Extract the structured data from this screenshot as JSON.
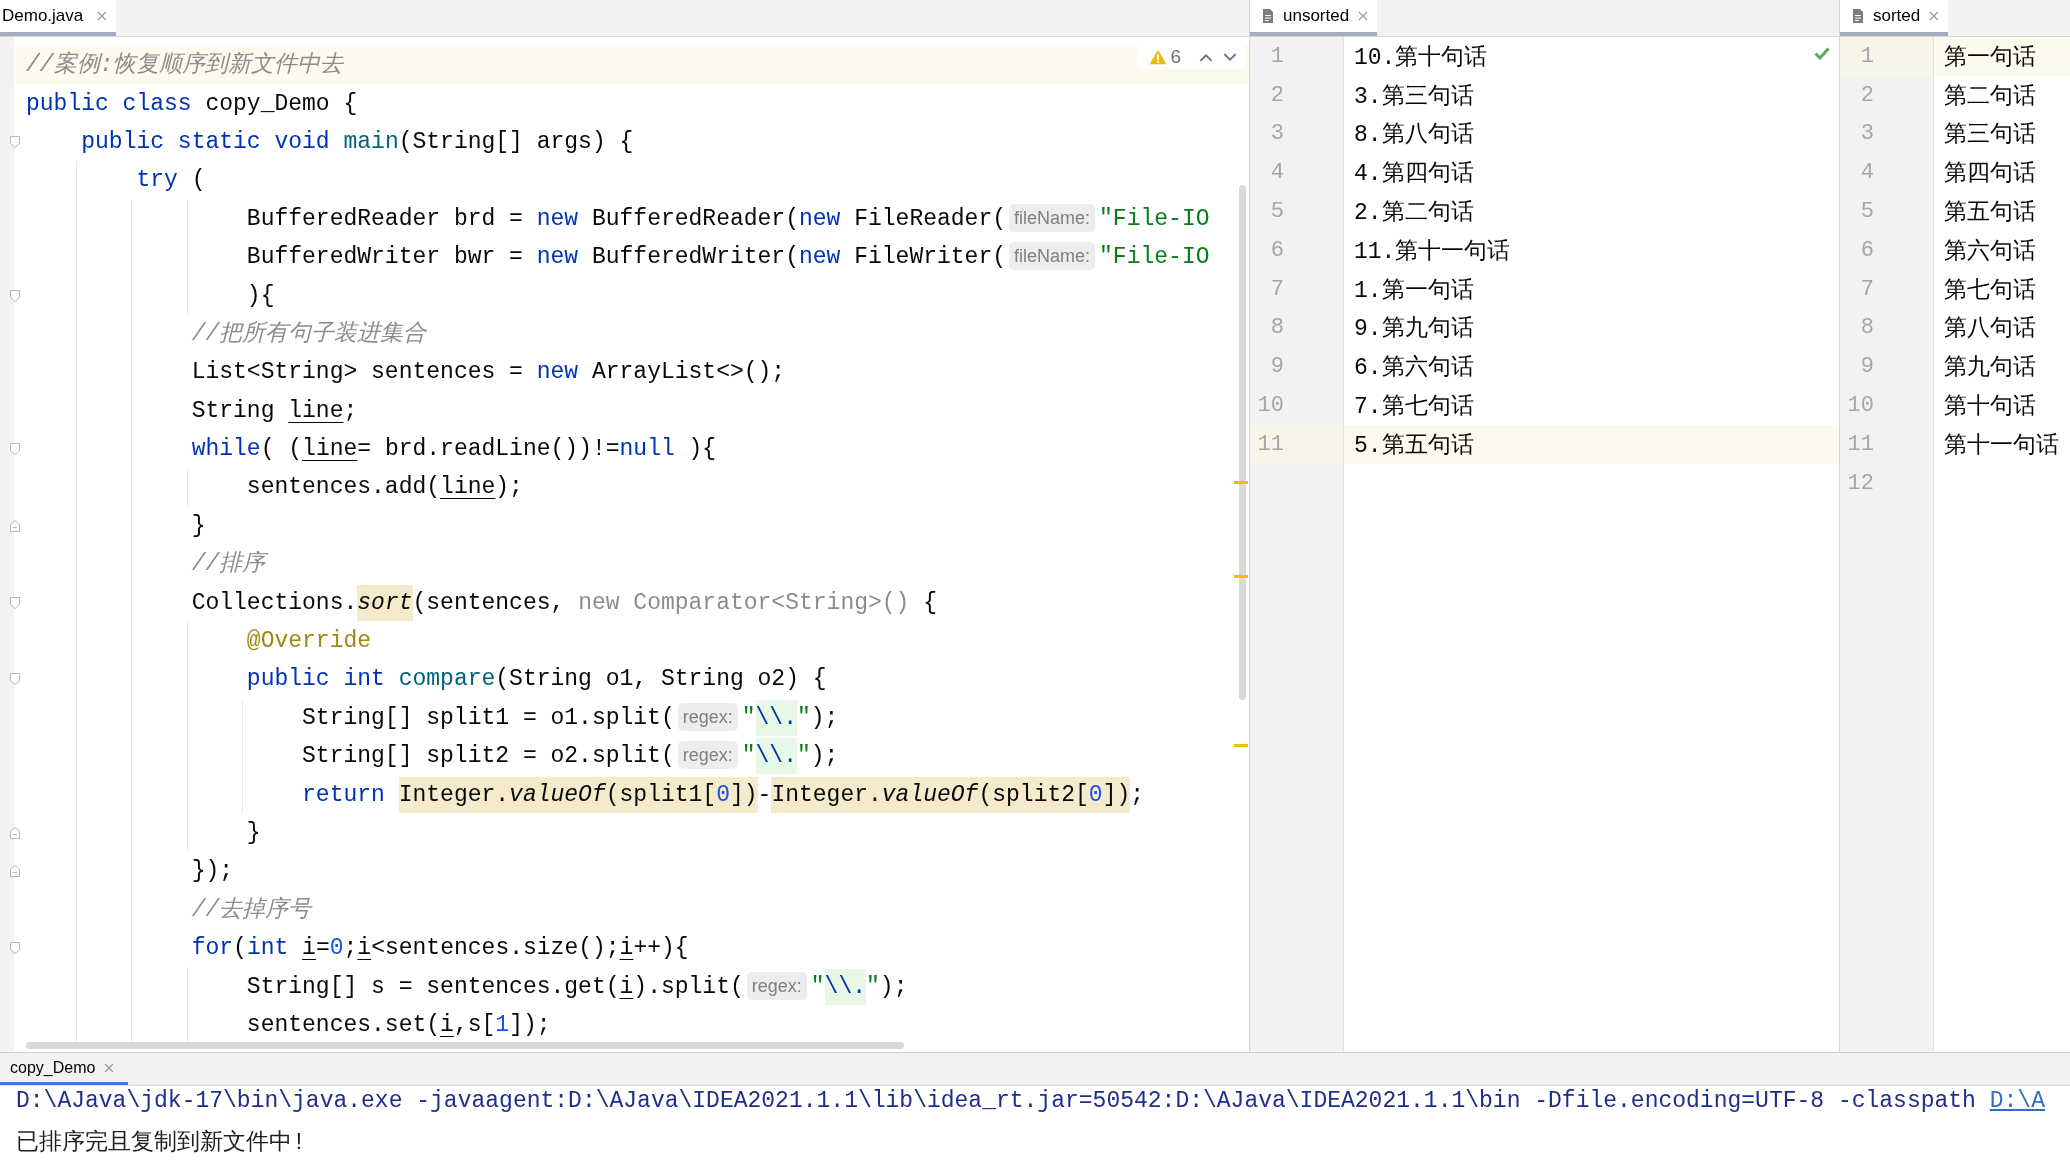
{
  "editor": {
    "tabs": [
      {
        "label": "Demo.java",
        "selected": true
      }
    ],
    "inspection": {
      "warning_count": "6"
    },
    "lines": [
      {
        "kind": "plain",
        "current": true,
        "tokens": [
          {
            "text": "//案例:恢复顺序到新文件中去",
            "kind": "comment"
          }
        ]
      },
      {
        "kind": "plain",
        "current": false,
        "tokens": [
          {
            "text": "public class",
            "kind": "keyword"
          },
          {
            "text": " copy_Demo {",
            "kind": "plain"
          }
        ]
      },
      {
        "kind": "fold_start",
        "current": false,
        "tokens": [
          {
            "text": "    public static void",
            "kind": "keyword"
          },
          {
            "text": " main",
            "kind": "method"
          },
          {
            "text": "(String[] args) {",
            "kind": "plain"
          }
        ]
      },
      {
        "kind": "plain",
        "current": false,
        "tokens": [
          {
            "text": "        try",
            "kind": "keyword"
          },
          {
            "text": " (",
            "kind": "plain"
          }
        ]
      },
      {
        "kind": "plain",
        "current": false,
        "tokens": [
          {
            "text": "                BufferedReader brd = ",
            "kind": "plain"
          },
          {
            "text": "new",
            "kind": "keyword"
          },
          {
            "text": " BufferedReader(",
            "kind": "plain"
          },
          {
            "text": "new",
            "kind": "keyword"
          },
          {
            "text": " FileReader(",
            "kind": "plain"
          },
          {
            "text": "fileName:",
            "kind": "hint"
          },
          {
            "text": "\"File-IO",
            "kind": "string"
          }
        ]
      },
      {
        "kind": "plain",
        "current": false,
        "tokens": [
          {
            "text": "                BufferedWriter bwr = ",
            "kind": "plain"
          },
          {
            "text": "new",
            "kind": "keyword"
          },
          {
            "text": " BufferedWriter(",
            "kind": "plain"
          },
          {
            "text": "new",
            "kind": "keyword"
          },
          {
            "text": " FileWriter(",
            "kind": "plain"
          },
          {
            "text": "fileName:",
            "kind": "hint"
          },
          {
            "text": "\"File-IO",
            "kind": "string"
          }
        ]
      },
      {
        "kind": "fold_start",
        "current": false,
        "tokens": [
          {
            "text": "                ){",
            "kind": "plain"
          }
        ]
      },
      {
        "kind": "plain",
        "current": false,
        "tokens": [
          {
            "text": "            //把所有句子装进集合",
            "kind": "comment"
          }
        ]
      },
      {
        "kind": "plain",
        "current": false,
        "tokens": [
          {
            "text": "            List<String> sentences = ",
            "kind": "plain"
          },
          {
            "text": "new",
            "kind": "keyword"
          },
          {
            "text": " ArrayList<>();",
            "kind": "plain"
          }
        ]
      },
      {
        "kind": "plain",
        "current": false,
        "tokens": [
          {
            "text": "            String ",
            "kind": "plain"
          },
          {
            "text": "line",
            "kind": "variable"
          },
          {
            "text": ";",
            "kind": "plain"
          }
        ]
      },
      {
        "kind": "fold_start",
        "current": false,
        "tokens": [
          {
            "text": "            while",
            "kind": "keyword"
          },
          {
            "text": "( (",
            "kind": "plain"
          },
          {
            "text": "line",
            "kind": "variable"
          },
          {
            "text": "= brd.readLine())!=",
            "kind": "plain"
          },
          {
            "text": "null",
            "kind": "keyword"
          },
          {
            "text": " ){",
            "kind": "plain"
          }
        ]
      },
      {
        "kind": "plain",
        "current": false,
        "tokens": [
          {
            "text": "                sentences.add(",
            "kind": "plain"
          },
          {
            "text": "line",
            "kind": "variable"
          },
          {
            "text": ");",
            "kind": "plain"
          }
        ]
      },
      {
        "kind": "fold_end",
        "current": false,
        "tokens": [
          {
            "text": "            }",
            "kind": "plain"
          }
        ]
      },
      {
        "kind": "plain",
        "current": false,
        "tokens": [
          {
            "text": "            //排序",
            "kind": "comment"
          }
        ]
      },
      {
        "kind": "fold_start",
        "current": false,
        "tokens": [
          {
            "text": "            Collections.",
            "kind": "plain"
          },
          {
            "text": "sort",
            "kind": "static_call",
            "highlighted": true
          },
          {
            "text": "(sentences, ",
            "kind": "plain"
          },
          {
            "text": "new Comparator<String>()",
            "kind": "dimmed"
          },
          {
            "text": " {",
            "kind": "plain"
          }
        ]
      },
      {
        "kind": "plain",
        "current": false,
        "tokens": [
          {
            "text": "                @Override",
            "kind": "annotation"
          }
        ]
      },
      {
        "kind": "fold_start",
        "current": false,
        "tokens": [
          {
            "text": "                public int",
            "kind": "keyword"
          },
          {
            "text": " compare",
            "kind": "method"
          },
          {
            "text": "(String o1, String o2) {",
            "kind": "plain"
          }
        ]
      },
      {
        "kind": "plain",
        "current": false,
        "tokens": [
          {
            "text": "                    String[] split1 = o1.split(",
            "kind": "plain"
          },
          {
            "text": "regex:",
            "kind": "hint"
          },
          {
            "text": "\"",
            "kind": "string"
          },
          {
            "text": "\\\\.",
            "kind": "regex"
          },
          {
            "text": "\"",
            "kind": "string"
          },
          {
            "text": ");",
            "kind": "plain"
          }
        ]
      },
      {
        "kind": "plain",
        "current": false,
        "tokens": [
          {
            "text": "                    String[] split2 = o2.split(",
            "kind": "plain"
          },
          {
            "text": "regex:",
            "kind": "hint"
          },
          {
            "text": "\"",
            "kind": "string"
          },
          {
            "text": "\\\\.",
            "kind": "regex"
          },
          {
            "text": "\"",
            "kind": "string"
          },
          {
            "text": ");",
            "kind": "plain"
          }
        ]
      },
      {
        "kind": "plain",
        "current": false,
        "tokens": [
          {
            "text": "                    return ",
            "kind": "keyword"
          },
          {
            "text": "Integer.",
            "kind": "plain",
            "highlighted": true
          },
          {
            "text": "valueOf",
            "kind": "static_call",
            "highlighted": true
          },
          {
            "text": "(split1[",
            "kind": "plain",
            "highlighted": true
          },
          {
            "text": "0",
            "kind": "number",
            "highlighted": true
          },
          {
            "text": "])",
            "kind": "plain",
            "highlighted": true
          },
          {
            "text": "-",
            "kind": "plain"
          },
          {
            "text": "Integer.",
            "kind": "plain",
            "highlighted": true
          },
          {
            "text": "valueOf",
            "kind": "static_call",
            "highlighted": true
          },
          {
            "text": "(split2[",
            "kind": "plain",
            "highlighted": true
          },
          {
            "text": "0",
            "kind": "number",
            "highlighted": true
          },
          {
            "text": "])",
            "kind": "plain",
            "highlighted": true
          },
          {
            "text": ";",
            "kind": "plain"
          }
        ]
      },
      {
        "kind": "fold_end",
        "current": false,
        "tokens": [
          {
            "text": "                }",
            "kind": "plain"
          }
        ]
      },
      {
        "kind": "fold_end",
        "current": false,
        "tokens": [
          {
            "text": "            });",
            "kind": "plain"
          }
        ]
      },
      {
        "kind": "plain",
        "current": false,
        "tokens": [
          {
            "text": "            //去掉序号",
            "kind": "comment"
          }
        ]
      },
      {
        "kind": "fold_start",
        "current": false,
        "tokens": [
          {
            "text": "            for",
            "kind": "keyword"
          },
          {
            "text": "(",
            "kind": "plain"
          },
          {
            "text": "int ",
            "kind": "keyword"
          },
          {
            "text": "i",
            "kind": "variable"
          },
          {
            "text": "=",
            "kind": "plain"
          },
          {
            "text": "0",
            "kind": "number"
          },
          {
            "text": ";",
            "kind": "plain"
          },
          {
            "text": "i",
            "kind": "variable"
          },
          {
            "text": "<sentences.size();",
            "kind": "plain"
          },
          {
            "text": "i",
            "kind": "variable"
          },
          {
            "text": "++){",
            "kind": "plain"
          }
        ]
      },
      {
        "kind": "plain",
        "current": false,
        "tokens": [
          {
            "text": "                String[] s = sentences.get(",
            "kind": "plain"
          },
          {
            "text": "i",
            "kind": "variable"
          },
          {
            "text": ").split(",
            "kind": "plain"
          },
          {
            "text": "regex:",
            "kind": "hint"
          },
          {
            "text": "\"",
            "kind": "string"
          },
          {
            "text": "\\\\.",
            "kind": "regex"
          },
          {
            "text": "\"",
            "kind": "string"
          },
          {
            "text": ");",
            "kind": "plain"
          }
        ]
      },
      {
        "kind": "plain",
        "current": false,
        "tokens": [
          {
            "text": "                sentences.set(",
            "kind": "plain"
          },
          {
            "text": "i",
            "kind": "variable"
          },
          {
            "text": ",s[",
            "kind": "plain"
          },
          {
            "text": "1",
            "kind": "number"
          },
          {
            "text": "]);",
            "kind": "plain"
          }
        ]
      }
    ]
  },
  "text_panes": [
    {
      "tabs": [
        {
          "label": "unsorted",
          "selected": true
        }
      ],
      "no_problems": true,
      "lines": [
        {
          "number": "1",
          "text": "10.第十句话",
          "current": false
        },
        {
          "number": "2",
          "text": "3.第三句话",
          "current": false
        },
        {
          "number": "3",
          "text": "8.第八句话",
          "current": false
        },
        {
          "number": "4",
          "text": "4.第四句话",
          "current": false
        },
        {
          "number": "5",
          "text": "2.第二句话",
          "current": false
        },
        {
          "number": "6",
          "text": "11.第十一句话",
          "current": false
        },
        {
          "number": "7",
          "text": "1.第一句话",
          "current": false
        },
        {
          "number": "8",
          "text": "9.第九句话",
          "current": false
        },
        {
          "number": "9",
          "text": "6.第六句话",
          "current": false
        },
        {
          "number": "10",
          "text": "7.第七句话",
          "current": false
        },
        {
          "number": "11",
          "text": "5.第五句话",
          "current": true
        }
      ]
    },
    {
      "tabs": [
        {
          "label": "sorted",
          "selected": true
        }
      ],
      "lines": [
        {
          "number": "1",
          "text": "第一句话",
          "current": true
        },
        {
          "number": "2",
          "text": "第二句话",
          "current": false
        },
        {
          "number": "3",
          "text": "第三句话",
          "current": false
        },
        {
          "number": "4",
          "text": "第四句话",
          "current": false
        },
        {
          "number": "5",
          "text": "第五句话",
          "current": false
        },
        {
          "number": "6",
          "text": "第六句话",
          "current": false
        },
        {
          "number": "7",
          "text": "第七句话",
          "current": false
        },
        {
          "number": "8",
          "text": "第八句话",
          "current": false
        },
        {
          "number": "9",
          "text": "第九句话",
          "current": false
        },
        {
          "number": "10",
          "text": "第十句话",
          "current": false
        },
        {
          "number": "11",
          "text": "第十一句话",
          "current": false
        },
        {
          "number": "12",
          "current": false
        }
      ]
    }
  ],
  "run_panel": {
    "tabs": [
      {
        "label": "copy_Demo",
        "selected": true
      }
    ],
    "console": [
      {
        "kind": "command",
        "text": "D:\\AJava\\jdk-17\\bin\\java.exe -javaagent:D:\\AJava\\IDEA2021.1.1\\lib\\idea_rt.jar=50542:D:\\AJava\\IDEA2021.1.1\\bin -Dfile.encoding=UTF-8 -classpath",
        "link": "D:\\A"
      },
      {
        "kind": "output",
        "text": "已排序完且复制到新文件中!"
      }
    ]
  }
}
